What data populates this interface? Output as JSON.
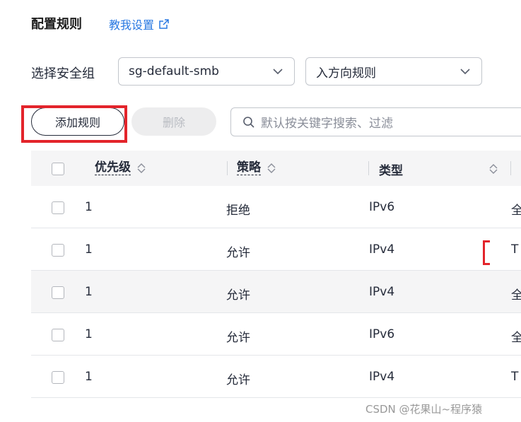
{
  "header": {
    "title": "配置规则",
    "help_link": "教我设置"
  },
  "filters": {
    "sg_label": "选择安全组",
    "sg_value": "sg-default-smb",
    "direction_value": "入方向规则"
  },
  "toolbar": {
    "add_label": "添加规则",
    "delete_label": "删除",
    "search_placeholder": "默认按关键字搜索、过滤"
  },
  "table": {
    "columns": [
      "优先级",
      "策略",
      "类型"
    ],
    "rows": [
      {
        "priority": "1",
        "policy": "拒绝",
        "type": "IPv6",
        "edge": "全"
      },
      {
        "priority": "1",
        "policy": "允许",
        "type": "IPv4",
        "edge": "T"
      },
      {
        "priority": "1",
        "policy": "允许",
        "type": "IPv4",
        "edge": "全"
      },
      {
        "priority": "1",
        "policy": "允许",
        "type": "IPv6",
        "edge": "全"
      },
      {
        "priority": "1",
        "policy": "允许",
        "type": "IPv4",
        "edge": "T"
      }
    ]
  },
  "watermark": "CSDN @花果山~程序猿",
  "colors": {
    "link": "#2878e2",
    "highlight": "#e3242b",
    "header_bg": "#f5f5f6"
  }
}
